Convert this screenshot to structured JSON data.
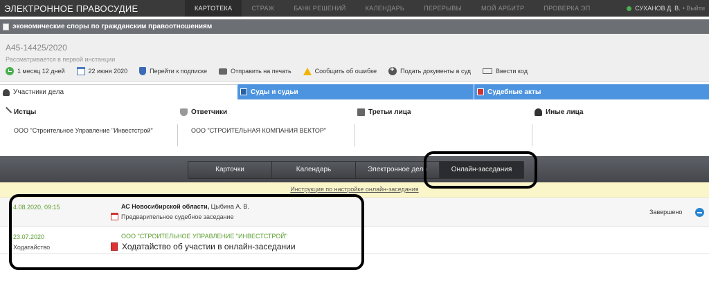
{
  "topbar": {
    "brand": "ЭЛЕКТРОННОЕ ПРАВОСУДИЕ",
    "nav": [
      "КАРТОТЕКА",
      "СТРАЖ",
      "БАНК РЕШЕНИЙ",
      "КАЛЕНДАРЬ",
      "ПЕРЕРЫВЫ",
      "МОЙ АРБИТР",
      "ПРОВЕРКА ЭП"
    ],
    "active_nav": "КАРТОТЕКА",
    "user": "СУХАНОВ Д. В.",
    "logout": "• Выйти"
  },
  "category": "экономические споры по гражданским правоотношениям",
  "case": {
    "number": "А45-14425/2020",
    "status": "Рассматривается в первой инстанции",
    "actions": [
      {
        "label": "1 месяц 12 дней",
        "icon": "clock-icon"
      },
      {
        "label": "22 июня 2020",
        "icon": "calendar-icon"
      },
      {
        "label": "Перейти к подписке",
        "icon": "shield-icon"
      },
      {
        "label": "Отправить на печать",
        "icon": "printer-icon"
      },
      {
        "label": "Сообщить об ошибке",
        "icon": "warning-icon"
      },
      {
        "label": "Подать документы в суд",
        "icon": "plus-icon"
      },
      {
        "label": "Ввести код",
        "icon": "code-icon"
      }
    ]
  },
  "tabs": [
    {
      "label": "Участники дела",
      "icon": "person-icon"
    },
    {
      "label": "Суды и судьи",
      "icon": "court-icon"
    },
    {
      "label": "Судебные акты",
      "icon": "act-icon"
    }
  ],
  "participants": [
    {
      "title": "Истцы",
      "value": "ООО \"Строительное Управление \"Инвестстрой\"",
      "icon": "swords-icon"
    },
    {
      "title": "Ответчики",
      "value": "ООО \"СТРОИТЕЛЬНАЯ КОМПАНИЯ ВЕКТОР\"",
      "icon": "shield-icon"
    },
    {
      "title": "Третьи лица",
      "value": "",
      "icon": "building-icon"
    },
    {
      "title": "Иные лица",
      "value": "",
      "icon": "person-icon"
    }
  ],
  "segments": [
    "Карточки",
    "Календарь",
    "Электронное дело",
    "Онлайн-заседания"
  ],
  "active_segment": "Онлайн-заседания",
  "instruction_link": "Инструкция по настройке онлайн-заседания",
  "session": {
    "datetime": "4.08.2020, 09:15",
    "court": "АС Новосибирской области,",
    "judge": " Цыбина А. В.",
    "type": "Предварительное судебное заседание",
    "state": "Завершено"
  },
  "document": {
    "date": "23.07.2020",
    "kind": "Ходатайство",
    "party": "ООО \"СТРОИТЕЛЬНОЕ УПРАВЛЕНИЕ \"ИНВЕСТСТРОЙ\"",
    "title": "Ходатайство об участии в онлайн-заседании"
  },
  "colors": {
    "topbar": "#3a3a3a",
    "tab_blue": "#4d94e0",
    "date_green": "#5b9e2f",
    "notice_yellow": "#fbf6c9"
  }
}
